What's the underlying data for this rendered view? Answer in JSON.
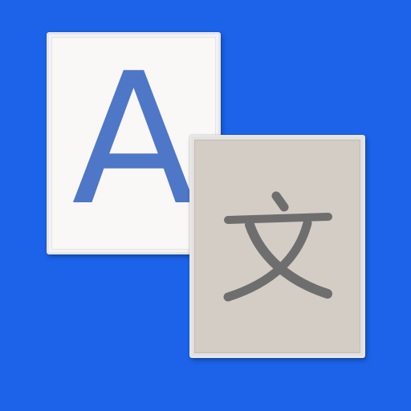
{
  "icon": {
    "front_card": {
      "glyph": "A",
      "glyph_color": "#4f77c8",
      "card_color": "#faf7f7"
    },
    "back_card": {
      "glyph": "文",
      "glyph_color": "#6f6e6e",
      "card_color": "#d3cdc6"
    },
    "background_color": "#1c63ea"
  }
}
